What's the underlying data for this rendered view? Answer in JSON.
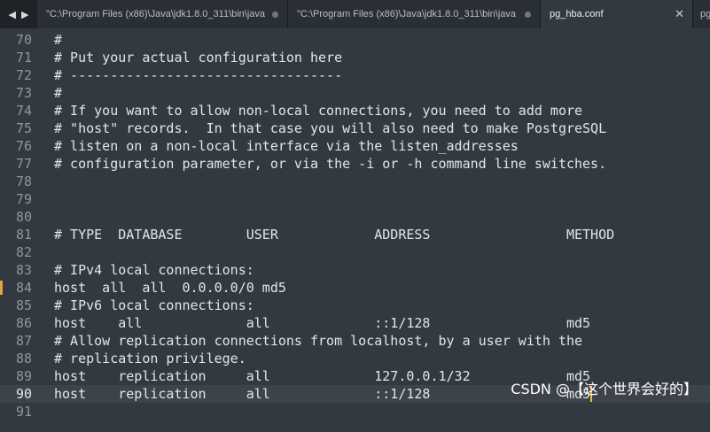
{
  "colors": {
    "editor_background": "#333940",
    "tabbar_background": "#1f2327",
    "text": "#e3e6e9",
    "gutter_text": "#8f969e",
    "modified_marker": "#e6a23c",
    "caret": "#f5b841"
  },
  "nav": {
    "back_icon": "triangle-left-icon",
    "back_glyph": "◀",
    "forward_icon": "triangle-right-icon",
    "forward_glyph": "▶"
  },
  "tabs": [
    {
      "label": "\"C:\\Program Files (x86)\\Java\\jdk1.8.0_311\\bin\\java",
      "active": false,
      "modified": true
    },
    {
      "label": "\"C:\\Program Files (x86)\\Java\\jdk1.8.0_311\\bin\\java",
      "active": false,
      "modified": true
    },
    {
      "label": "pg_hba.conf",
      "active": true,
      "close_glyph": "✕"
    },
    {
      "label": "pg"
    }
  ],
  "editor": {
    "current_line": 90,
    "modified_line": 84,
    "lines": [
      {
        "n": "70",
        "text": "#"
      },
      {
        "n": "71",
        "text": "# Put your actual configuration here"
      },
      {
        "n": "72",
        "text": "# ----------------------------------"
      },
      {
        "n": "73",
        "text": "#"
      },
      {
        "n": "74",
        "text": "# If you want to allow non-local connections, you need to add more"
      },
      {
        "n": "75",
        "text": "# \"host\" records.  In that case you will also need to make PostgreSQL"
      },
      {
        "n": "76",
        "text": "# listen on a non-local interface via the listen_addresses"
      },
      {
        "n": "77",
        "text": "# configuration parameter, or via the -i or -h command line switches."
      },
      {
        "n": "78",
        "text": ""
      },
      {
        "n": "79",
        "text": ""
      },
      {
        "n": "80",
        "text": ""
      },
      {
        "n": "81",
        "text": "# TYPE  DATABASE        USER            ADDRESS                 METHOD"
      },
      {
        "n": "82",
        "text": ""
      },
      {
        "n": "83",
        "text": "# IPv4 local connections:"
      },
      {
        "n": "84",
        "text": "host  all  all  0.0.0.0/0 md5"
      },
      {
        "n": "85",
        "text": "# IPv6 local connections:"
      },
      {
        "n": "86",
        "text": "host    all             all             ::1/128                 md5"
      },
      {
        "n": "87",
        "text": "# Allow replication connections from localhost, by a user with the"
      },
      {
        "n": "88",
        "text": "# replication privilege."
      },
      {
        "n": "89",
        "text": "host    replication     all             127.0.0.1/32            md5"
      },
      {
        "n": "90",
        "text": "host    replication     all             ::1/128                 md5"
      },
      {
        "n": "91",
        "text": ""
      }
    ]
  },
  "watermark": "CSDN @【这个世界会好的】"
}
